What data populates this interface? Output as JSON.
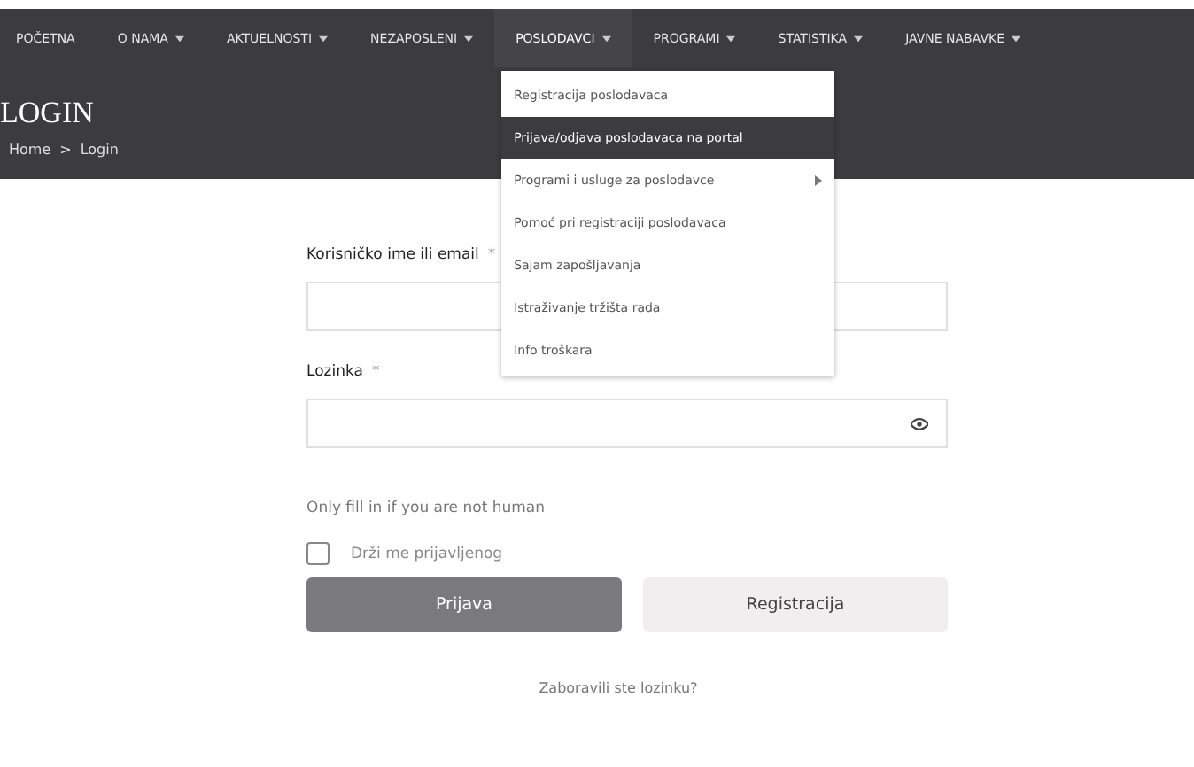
{
  "nav": [
    {
      "label": "POČETNA",
      "has_submenu": false,
      "expanded": false
    },
    {
      "label": "O NAMA",
      "has_submenu": true,
      "expanded": false
    },
    {
      "label": "AKTUELNOSTI",
      "has_submenu": true,
      "expanded": false
    },
    {
      "label": "NEZAPOSLENI",
      "has_submenu": true,
      "expanded": false
    },
    {
      "label": "POSLODAVCI",
      "has_submenu": true,
      "expanded": true
    },
    {
      "label": "PROGRAMI",
      "has_submenu": true,
      "expanded": false
    },
    {
      "label": "STATISTIKA",
      "has_submenu": true,
      "expanded": false
    },
    {
      "label": "JAVNE NABAVKE",
      "has_submenu": true,
      "expanded": false
    }
  ],
  "dropdown": [
    {
      "label": "Registracija poslodavaca",
      "selected": false,
      "has_submenu": false
    },
    {
      "label": "Prijava/odjava poslodavaca na portal",
      "selected": true,
      "has_submenu": false
    },
    {
      "label": "Programi i usluge za poslodavce",
      "selected": false,
      "has_submenu": true
    },
    {
      "label": "Pomoć pri registraciji poslodavaca",
      "selected": false,
      "has_submenu": false
    },
    {
      "label": "Sajam zapošljavanja",
      "selected": false,
      "has_submenu": false
    },
    {
      "label": "Istraživanje tržišta rada",
      "selected": false,
      "has_submenu": false
    },
    {
      "label": "Info troškara",
      "selected": false,
      "has_submenu": false
    }
  ],
  "page_title": "LOGIN",
  "breadcrumb": [
    "Home",
    "Login"
  ],
  "breadcrumb_separator": ">",
  "form": {
    "username_label": "Korisničko ime ili email",
    "password_label": "Lozinka",
    "required_mark": "*",
    "honeypot_text": "Only fill in if you are not human",
    "remember": {
      "label": "Drži me prijavljenog",
      "checked": false
    },
    "login_button": "Prijava",
    "register_button": "Registracija",
    "forgot_link": "Zaboravili ste lozinku?"
  }
}
